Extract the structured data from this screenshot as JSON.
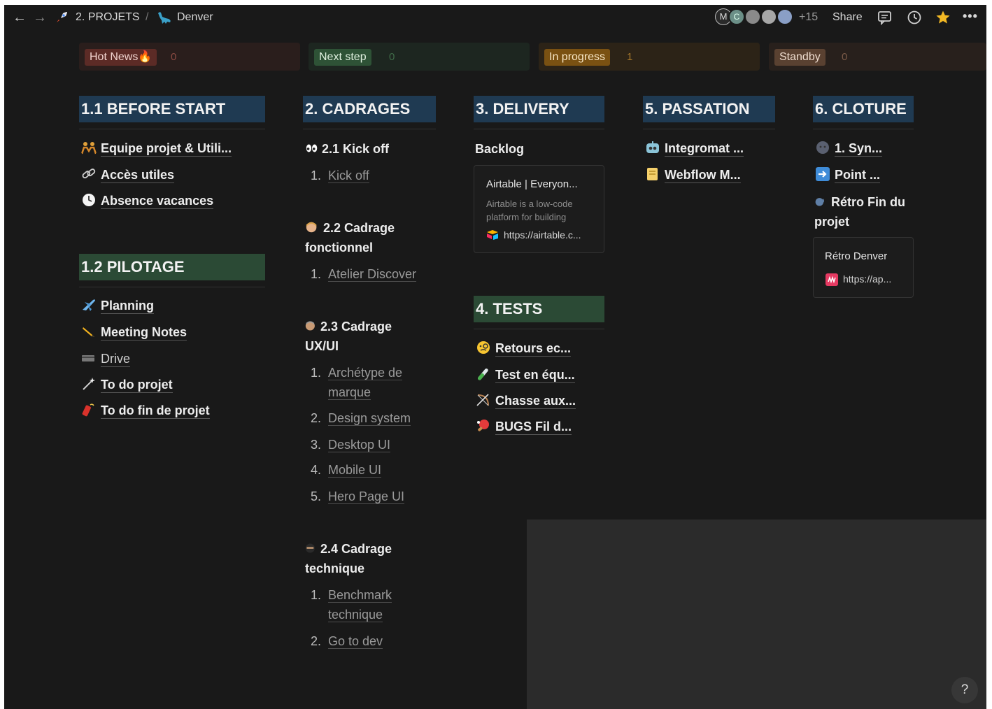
{
  "topbar": {
    "back_icon": "arrow-left-icon",
    "forward_icon": "arrow-right-icon",
    "breadcrumb": [
      {
        "icon": "rocket-emoji",
        "label": "2. PROJETS"
      },
      {
        "icon": "dinosaur-emoji",
        "label": "Denver"
      }
    ],
    "separator": "/",
    "avatars": [
      {
        "initial": "M"
      },
      {
        "initial": "C"
      },
      {
        "initial": ""
      },
      {
        "initial": ""
      },
      {
        "initial": ""
      }
    ],
    "more_members": "+15",
    "share_label": "Share",
    "icons": [
      "comments-icon",
      "history-clock-icon",
      "favorite-star-icon",
      "more-dots-icon"
    ],
    "more_label": "•••"
  },
  "statuses": [
    {
      "label": "Hot News🔥",
      "count": "0",
      "bg": "#3a2422",
      "tag_bg": "#5c2b26",
      "tag_color": "#f1d4cf",
      "count_color": "#8a4a42"
    },
    {
      "label": "Next step",
      "count": "0",
      "bg": "#1f2a22",
      "tag_bg": "#2e5236",
      "tag_color": "#dff0df",
      "count_color": "#3f6b48"
    },
    {
      "label": "In progress",
      "count": "1",
      "bg": "#352818",
      "tag_bg": "#7a5112",
      "tag_color": "#f8e7c6",
      "count_color": "#a5772a"
    },
    {
      "label": "Standby",
      "count": "0",
      "bg": "#2e2420",
      "tag_bg": "#5a4131",
      "tag_color": "#eedccf",
      "count_color": "#7a5a48"
    }
  ],
  "sections": {
    "before_start": {
      "title": "1.1 BEFORE START",
      "links": [
        {
          "emoji": "people-emoji",
          "label": "Equipe projet & Utili..."
        },
        {
          "emoji": "link-emoji",
          "label": "Accès utiles"
        },
        {
          "emoji": "clock-emoji",
          "label": "Absence vacances"
        }
      ]
    },
    "pilotage": {
      "title": "1.2 PILOTAGE",
      "links": [
        {
          "emoji": "airplane-emoji",
          "label": "Planning"
        },
        {
          "emoji": "pencil-emoji",
          "label": "Meeting Notes"
        },
        {
          "emoji": "card-emoji",
          "label": "Drive"
        },
        {
          "emoji": "wand-emoji",
          "label": "To do projet"
        },
        {
          "emoji": "firecracker-emoji",
          "label": "To do fin de projet"
        }
      ]
    },
    "cadrages": {
      "title": "2. CADRAGES",
      "groups": [
        {
          "emoji": "eyes-emoji",
          "title": "2.1 Kick off",
          "items": [
            {
              "n": "1.",
              "label": "Kick off"
            }
          ]
        },
        {
          "emoji": "person-emoji",
          "title_l1": "2.2 Cadrage",
          "title_l2": "fonctionnel",
          "items": [
            {
              "n": "1.",
              "label": "Atelier Discover"
            }
          ]
        },
        {
          "emoji": "face-emoji",
          "title_l1": "2.3 Cadrage",
          "title_l2": "UX/UI",
          "items": [
            {
              "n": "1.",
              "label_l1": "Archétype de",
              "label_l2": "marque"
            },
            {
              "n": "2.",
              "label": "Design system"
            },
            {
              "n": "3.",
              "label": "Desktop UI"
            },
            {
              "n": "4.",
              "label": "Mobile UI"
            },
            {
              "n": "5.",
              "label": "Hero Page UI"
            }
          ]
        },
        {
          "emoji": "ninja-emoji",
          "title_l1": "2.4 Cadrage",
          "title_l2": "technique",
          "items": [
            {
              "n": "1.",
              "label_l1": "Benchmark",
              "label_l2": "technique"
            },
            {
              "n": "2.",
              "label": "Go to dev"
            }
          ]
        }
      ]
    },
    "delivery": {
      "title": "3. DELIVERY",
      "backlog_label": "Backlog",
      "card": {
        "title": "Airtable | Everyon...",
        "desc_l1": "Airtable is a low-code",
        "desc_l2": "platform for building",
        "url": "https://airtable.c..."
      }
    },
    "tests": {
      "title": "4. TESTS",
      "links": [
        {
          "emoji": "monocle-emoji",
          "label": "Retours ec..."
        },
        {
          "emoji": "test-tube-emoji",
          "label": "Test en équ..."
        },
        {
          "emoji": "bow-emoji",
          "label": "Chasse aux..."
        },
        {
          "emoji": "ping-pong-emoji",
          "label": "BUGS Fil d..."
        }
      ]
    },
    "passation": {
      "title": "5. PASSATION",
      "links": [
        {
          "emoji": "robot-emoji",
          "label": "Integromat ..."
        },
        {
          "emoji": "note-emoji",
          "label": "Webflow M..."
        }
      ]
    },
    "cloture": {
      "title": "6. CLOTURE",
      "links": [
        {
          "emoji": "new-moon-emoji",
          "label": "1. Syn..."
        },
        {
          "emoji": "right-arrow-emoji",
          "label": "Point ..."
        }
      ],
      "retro_title_l1": "Rétro Fin du",
      "retro_title_l2": "projet",
      "card": {
        "title": "Rétro Denver",
        "url": "https://ap..."
      }
    }
  },
  "help_label": "?"
}
